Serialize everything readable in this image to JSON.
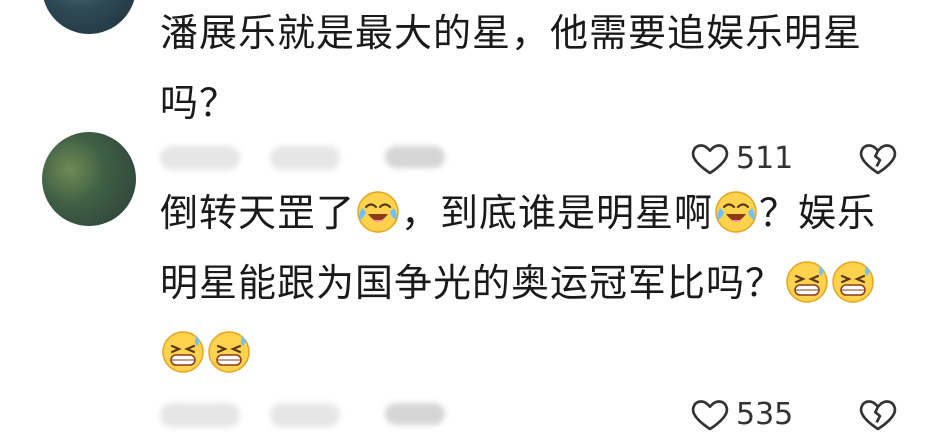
{
  "comments": [
    {
      "text_line1": "潘展乐就是最大的星，他需要追娱乐明星",
      "text_line2": "吗？",
      "likes": "511",
      "icons": [
        "heart-outline-icon",
        "broken-heart-icon"
      ]
    },
    {
      "text_part1": "倒转天罡了",
      "text_part2": "，到底谁是明星啊",
      "text_part3": "？娱乐",
      "text_line2": "明星能跟为国争光的奥运冠军比吗？",
      "likes": "535",
      "icons": [
        "laugh-cry-emoji",
        "grin-sweat-emoji",
        "heart-outline-icon",
        "broken-heart-icon"
      ]
    }
  ]
}
